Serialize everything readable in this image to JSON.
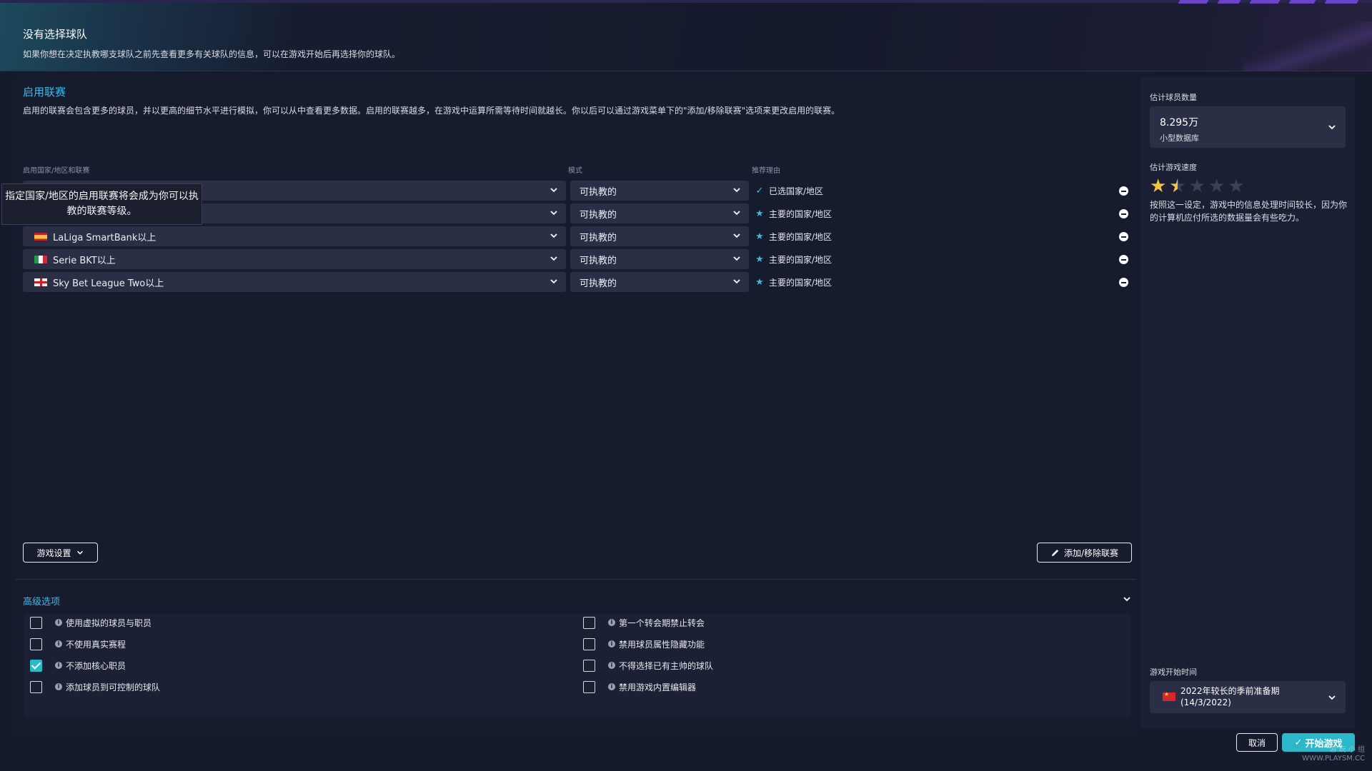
{
  "header": {
    "title": "没有选择球队",
    "subtitle": "如果你想在决定执教哪支球队之前先查看更多有关球队的信息，可以在游戏开始后再选择你的球队。"
  },
  "leagues_section": {
    "title": "启用联赛",
    "description": "启用的联赛会包含更多的球员，并以更高的细节水平进行模拟，你可以从中查看更多数据。启用的联赛越多，在游戏中运算所需等待时间就越长。你以后可以通过游戏菜单下的\"添加/移除联赛\"选项来更改启用的联赛。",
    "columns": {
      "league": "启用国家/地区和联赛",
      "mode": "模式",
      "reason": "推荐理由"
    },
    "tooltip": "指定国家/地区的启用联赛将会成为你可以执教的联赛等级。",
    "rows": [
      {
        "league": "",
        "flag": "",
        "mode": "可执教的",
        "reason": "已选国家/地区",
        "reason_icon": "check-icon"
      },
      {
        "league": "",
        "flag": "",
        "mode": "可执教的",
        "reason": "主要的国家/地区",
        "reason_icon": "star-icon"
      },
      {
        "league": "LaLiga SmartBank以上",
        "flag": "spain-flag-icon",
        "mode": "可执教的",
        "reason": "主要的国家/地区",
        "reason_icon": "star-icon"
      },
      {
        "league": "Serie BKT以上",
        "flag": "italy-flag-icon",
        "mode": "可执教的",
        "reason": "主要的国家/地区",
        "reason_icon": "star-icon"
      },
      {
        "league": "Sky Bet League Two以上",
        "flag": "england-flag-icon",
        "mode": "可执教的",
        "reason": "主要的国家/地区",
        "reason_icon": "star-icon"
      }
    ],
    "game_settings_button": "游戏设置",
    "add_remove_button": "添加/移除联赛"
  },
  "advanced": {
    "title": "高级选项",
    "left_options": [
      {
        "label": "使用虚拟的球员与职员",
        "checked": false
      },
      {
        "label": "不使用真实赛程",
        "checked": false
      },
      {
        "label": "不添加核心职员",
        "checked": true
      },
      {
        "label": "添加球员到可控制的球队",
        "checked": false
      }
    ],
    "right_options": [
      {
        "label": "第一个转会期禁止转会",
        "checked": false
      },
      {
        "label": "禁用球员属性隐藏功能",
        "checked": false
      },
      {
        "label": "不得选择已有主帅的球队",
        "checked": false
      },
      {
        "label": "禁用游戏内置编辑器",
        "checked": false
      }
    ]
  },
  "side": {
    "player_count_label": "估计球员数量",
    "player_count_value": "8.295万",
    "player_count_sub": "小型数据库",
    "speed_label": "估计游戏速度",
    "speed_rating": 1.5,
    "speed_max": 5,
    "speed_desc": "按照这一设定，游戏中的信息处理时间较长，因为你的计算机应付所选的数据量会有些吃力。",
    "start_time_label": "游戏开始时间",
    "start_time_line1": "2022年较长的季前准备期",
    "start_time_line2": "(14/3/2022)",
    "start_time_flag": "china-flag-icon"
  },
  "footer": {
    "cancel": "取消",
    "start": "开始游戏"
  },
  "watermark": {
    "line1": "游 玩 小 组",
    "line2": "WWW.PLAYSM.CC"
  },
  "colors": {
    "accent": "#3fb7e6",
    "teal": "#2bb8c9",
    "star": "#f5c343",
    "bg": "#161a2d"
  }
}
